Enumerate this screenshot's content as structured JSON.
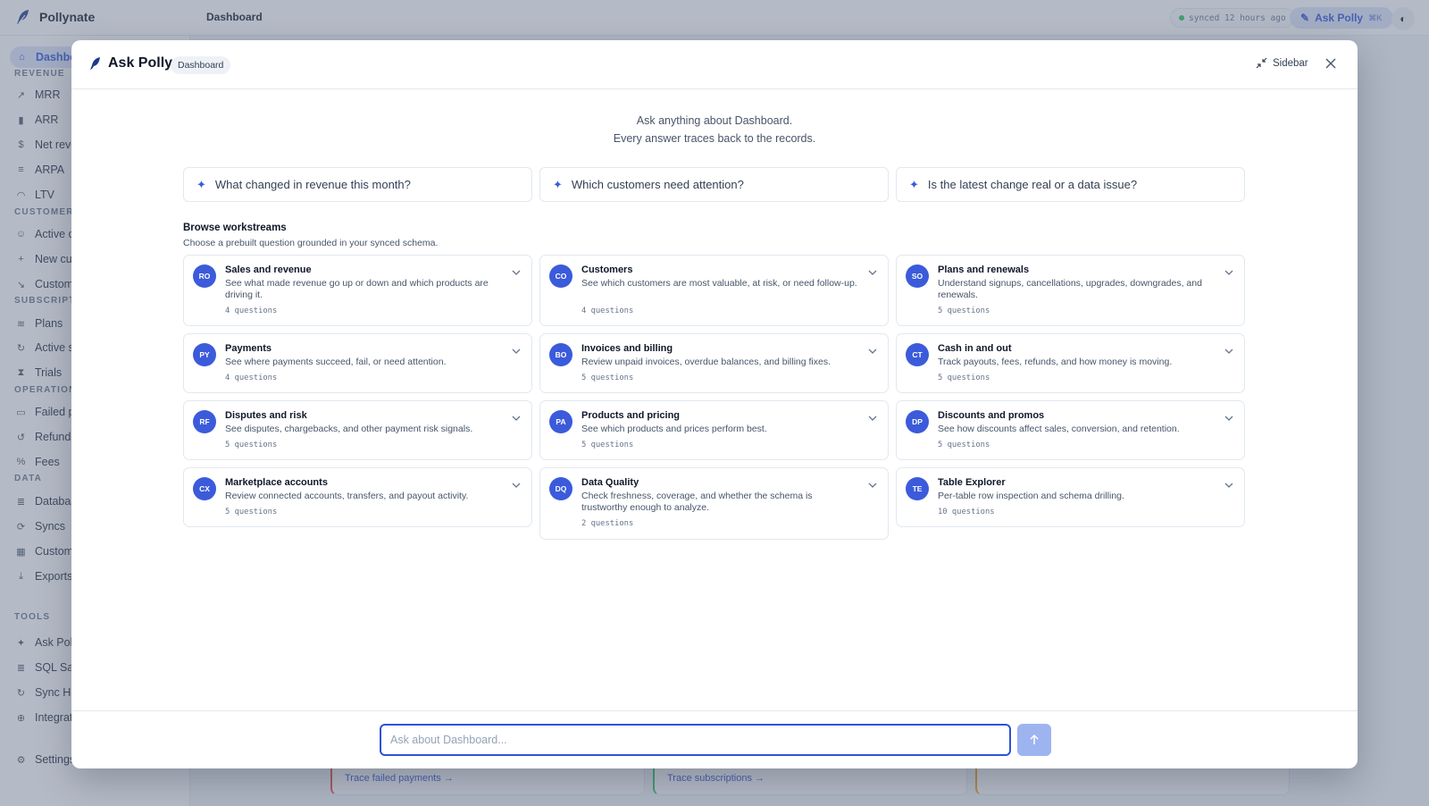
{
  "app": {
    "brand": "Pollynate",
    "page_title": "Dashboard",
    "sync_status": "synced 12 hours ago",
    "ask_label": "Ask Polly",
    "ask_shortcut": "⌘K"
  },
  "sidebar": {
    "groups": [
      {
        "label": "REVENUE"
      },
      {
        "label": "CUSTOMER"
      },
      {
        "label": "SUBSCRIPT"
      },
      {
        "label": "OPERATION"
      },
      {
        "label": "DATA"
      },
      {
        "label": "TOOLS"
      }
    ],
    "items": [
      {
        "label": "Dashbo",
        "icon": "home-icon"
      },
      {
        "label": "MRR",
        "icon": "trend-icon"
      },
      {
        "label": "ARR",
        "icon": "bar-chart-icon"
      },
      {
        "label": "Net reve",
        "icon": "dollar-icon"
      },
      {
        "label": "ARPA",
        "icon": "stack-icon"
      },
      {
        "label": "LTV",
        "icon": "gauge-icon"
      },
      {
        "label": "Active c",
        "icon": "users-icon"
      },
      {
        "label": "New cu",
        "icon": "user-plus-icon"
      },
      {
        "label": "Custom",
        "icon": "trend-down-icon"
      },
      {
        "label": "Plans",
        "icon": "layers-icon"
      },
      {
        "label": "Active s",
        "icon": "refresh-icon"
      },
      {
        "label": "Trials",
        "icon": "hourglass-icon"
      },
      {
        "label": "Failed p",
        "icon": "card-icon"
      },
      {
        "label": "Refunds",
        "icon": "undo-icon"
      },
      {
        "label": "Fees",
        "icon": "percent-icon"
      },
      {
        "label": "Databas",
        "icon": "database-icon"
      },
      {
        "label": "Syncs",
        "icon": "sync-icon"
      },
      {
        "label": "Custom",
        "icon": "table-icon"
      },
      {
        "label": "Exports",
        "icon": "download-icon"
      },
      {
        "label": "Ask Poll",
        "icon": "sparkle-icon"
      },
      {
        "label": "SQL Sar",
        "icon": "database-icon"
      },
      {
        "label": "Sync Hi",
        "icon": "history-icon"
      },
      {
        "label": "Integrat",
        "icon": "plug-icon"
      },
      {
        "label": "Settings",
        "icon": "gear-icon"
      }
    ]
  },
  "background_cards": [
    {
      "link": "Trace failed payments →",
      "accent": "#ef4444"
    },
    {
      "link": "Trace subscriptions →",
      "accent": "#22c55e"
    },
    {
      "link": "",
      "accent": "#f59e0b"
    }
  ],
  "modal": {
    "title": "Ask Polly",
    "context_badge": "Dashboard",
    "sidebar_label": "Sidebar",
    "intro_line1": "Ask anything about Dashboard.",
    "intro_line2": "Every answer traces back to the records.",
    "suggestions": [
      "What changed in revenue this month?",
      "Which customers need attention?",
      "Is the latest change real or a data issue?"
    ],
    "workstreams_title": "Browse workstreams",
    "workstreams_subtitle": "Choose a prebuilt question grounded in your synced schema.",
    "workstreams": [
      {
        "abbr": "RO",
        "name": "Sales and revenue",
        "desc": "See what made revenue go up or down and which products are driving it.",
        "count": "4 questions"
      },
      {
        "abbr": "CO",
        "name": "Customers",
        "desc": "See which customers are most valuable, at risk, or need follow-up.",
        "count": "4 questions"
      },
      {
        "abbr": "SO",
        "name": "Plans and renewals",
        "desc": "Understand signups, cancellations, upgrades, downgrades, and renewals.",
        "count": "5 questions"
      },
      {
        "abbr": "PY",
        "name": "Payments",
        "desc": "See where payments succeed, fail, or need attention.",
        "count": "4 questions"
      },
      {
        "abbr": "BO",
        "name": "Invoices and billing",
        "desc": "Review unpaid invoices, overdue balances, and billing fixes.",
        "count": "5 questions"
      },
      {
        "abbr": "CT",
        "name": "Cash in and out",
        "desc": "Track payouts, fees, refunds, and how money is moving.",
        "count": "5 questions"
      },
      {
        "abbr": "RF",
        "name": "Disputes and risk",
        "desc": "See disputes, chargebacks, and other payment risk signals.",
        "count": "5 questions"
      },
      {
        "abbr": "PA",
        "name": "Products and pricing",
        "desc": "See which products and prices perform best.",
        "count": "5 questions"
      },
      {
        "abbr": "DP",
        "name": "Discounts and promos",
        "desc": "See how discounts affect sales, conversion, and retention.",
        "count": "5 questions"
      },
      {
        "abbr": "CX",
        "name": "Marketplace accounts",
        "desc": "Review connected accounts, transfers, and payout activity.",
        "count": "5 questions"
      },
      {
        "abbr": "DQ",
        "name": "Data Quality",
        "desc": "Check freshness, coverage, and whether the schema is trustworthy enough to analyze.",
        "count": "2 questions"
      },
      {
        "abbr": "TE",
        "name": "Table Explorer",
        "desc": "Per-table row inspection and schema drilling.",
        "count": "10 questions"
      }
    ],
    "input_placeholder": "Ask about Dashboard...",
    "input_value": ""
  },
  "colors": {
    "accent": "#2f52d6",
    "avatar": "#3b5bdb",
    "send_disabled": "#9db4f0"
  }
}
